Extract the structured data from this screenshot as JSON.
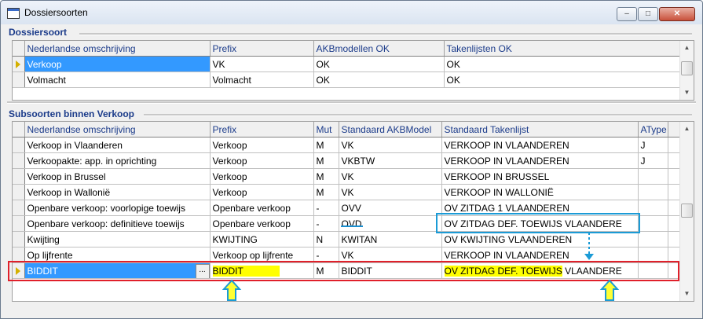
{
  "window": {
    "title": "Dossiersoorten",
    "minimize_symbol": "‒",
    "maximize_symbol": "□",
    "close_symbol": "✕"
  },
  "dossiersoort": {
    "group_label": "Dossiersoort",
    "columns": [
      "Nederlandse omschrijving",
      "Prefix",
      "AKBmodellen OK",
      "Takenlijsten OK"
    ],
    "rows": [
      [
        "Verkoop",
        "VK",
        "OK",
        "OK"
      ],
      [
        "Volmacht",
        "Volmacht",
        "OK",
        "OK"
      ]
    ],
    "selected_row": 0
  },
  "subsoorten": {
    "group_label": "Subsoorten binnen Verkoop",
    "columns": [
      "Nederlandse omschrijving",
      "Prefix",
      "Mut",
      "Standaard AKBModel",
      "Standaard Takenlijst",
      "AType"
    ],
    "rows": [
      [
        "Verkoop in Vlaanderen",
        "Verkoop",
        "M",
        "VK",
        "VERKOOP IN VLAANDEREN",
        "J"
      ],
      [
        "Verkoopakte: app. in oprichting",
        "Verkoop",
        "M",
        "VKBTW",
        "VERKOOP IN VLAANDEREN",
        "J"
      ],
      [
        "Verkoop in Brussel",
        "Verkoop",
        "M",
        "VK",
        "VERKOOP IN BRUSSEL",
        ""
      ],
      [
        "Verkoop in Wallonië",
        "Verkoop",
        "M",
        "VK",
        "VERKOOP IN WALLONIË",
        ""
      ],
      [
        "Openbare verkoop: voorlopige toewijs",
        "Openbare verkoop",
        "-",
        "OVV",
        "OV ZITDAG 1 VLAANDEREN",
        ""
      ],
      [
        "Openbare verkoop: definitieve toewijs",
        "Openbare verkoop",
        "-",
        "OVD",
        "OV ZITDAG DEF. TOEWIJS VLAANDERE",
        ""
      ],
      [
        "Kwijting",
        "KWIJTING",
        "N",
        "KWITAN",
        "OV KWIJTING VLAANDEREN",
        ""
      ],
      [
        "Op lijfrente",
        "Verkoop op lijfrente",
        "-",
        "VK",
        "VERKOOP IN VLAANDEREN",
        ""
      ]
    ],
    "edit_row": {
      "omschrijving": "BIDDIT",
      "ellipsis": "...",
      "prefix": "BIDDIT",
      "mut": "M",
      "akbmodel": "BIDDIT",
      "takenlijst_highlighted": "OV ZITDAG DEF. TOEWIJS",
      "takenlijst_rest": " VLAANDERE",
      "atype": ""
    }
  },
  "annotations": {
    "colors": {
      "red_box": "#e0202a",
      "blue_box": "#1b9bd6",
      "arrow_fill": "#ffff33",
      "arrow_stroke": "#1b9bd6",
      "highlight": "#ffff00"
    }
  }
}
